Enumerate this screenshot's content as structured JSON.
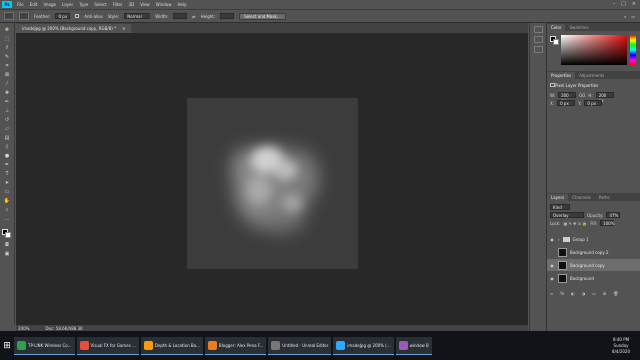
{
  "app": {
    "logo": "Ps"
  },
  "menu": [
    "File",
    "Edit",
    "Image",
    "Layer",
    "Type",
    "Select",
    "Filter",
    "3D",
    "View",
    "Window",
    "Help"
  ],
  "options": {
    "feather_label": "Feather:",
    "feather_value": "0 px",
    "antialias_label": "Anti-alias",
    "style_label": "Style:",
    "style_value": "Normal",
    "width_label": "Width:",
    "height_label": "Height:",
    "select_mask": "Select and Mask..."
  },
  "document_tab": {
    "title": "imadeJpg @ 200% (Background copy, RGB/8) *",
    "close": "×"
  },
  "status": {
    "zoom": "200%",
    "doc": "Doc: 58.6K/488.3K"
  },
  "panels": {
    "color_tabs": [
      "Color",
      "Swatches"
    ],
    "properties_tabs": [
      "Properties",
      "Adjustments"
    ],
    "properties_title": "Pixel Layer Properties",
    "props": {
      "w_label": "W:",
      "w_value": "200 px",
      "h_label": "H:",
      "h_value": "200 px",
      "go_label": "GO",
      "x_label": "X:",
      "x_value": "0 px",
      "y_label": "Y:",
      "y_value": "0 px"
    },
    "layers_tabs": [
      "Layers",
      "Channels",
      "Paths"
    ],
    "layers_kind": "Kind",
    "blend_mode": "Overlay",
    "opacity_label": "Opacity:",
    "opacity_value": "47%",
    "lock_label": "Lock:",
    "fill_label": "Fill:",
    "fill_value": "100%",
    "layers": [
      {
        "name": "Group 1",
        "type": "group",
        "visible": true,
        "selected": false
      },
      {
        "name": "Background copy 2",
        "type": "pixel",
        "visible": false,
        "selected": false
      },
      {
        "name": "Background copy",
        "type": "pixel",
        "visible": true,
        "selected": true
      },
      {
        "name": "Background",
        "type": "pixel",
        "visible": true,
        "selected": false
      }
    ]
  },
  "taskbar": {
    "items": [
      {
        "label": "TP-LINK Wireless Co...",
        "color": "#2ba24c"
      },
      {
        "label": "Visual FX for Games ...",
        "color": "#e74c3c"
      },
      {
        "label": "Depth & Location Ba...",
        "color": "#f39c12"
      },
      {
        "label": "Blogger: Alex Pena F...",
        "color": "#e67e22"
      },
      {
        "label": "Untitled - Unreal Editor",
        "color": "#777777"
      },
      {
        "label": "imadeJpg @ 200% (...",
        "color": "#31a8ff"
      },
      {
        "label": "window B",
        "color": "#9b59b6"
      }
    ],
    "time": "8:40 PM",
    "day": "Sunday",
    "date": "8/4/2020"
  }
}
